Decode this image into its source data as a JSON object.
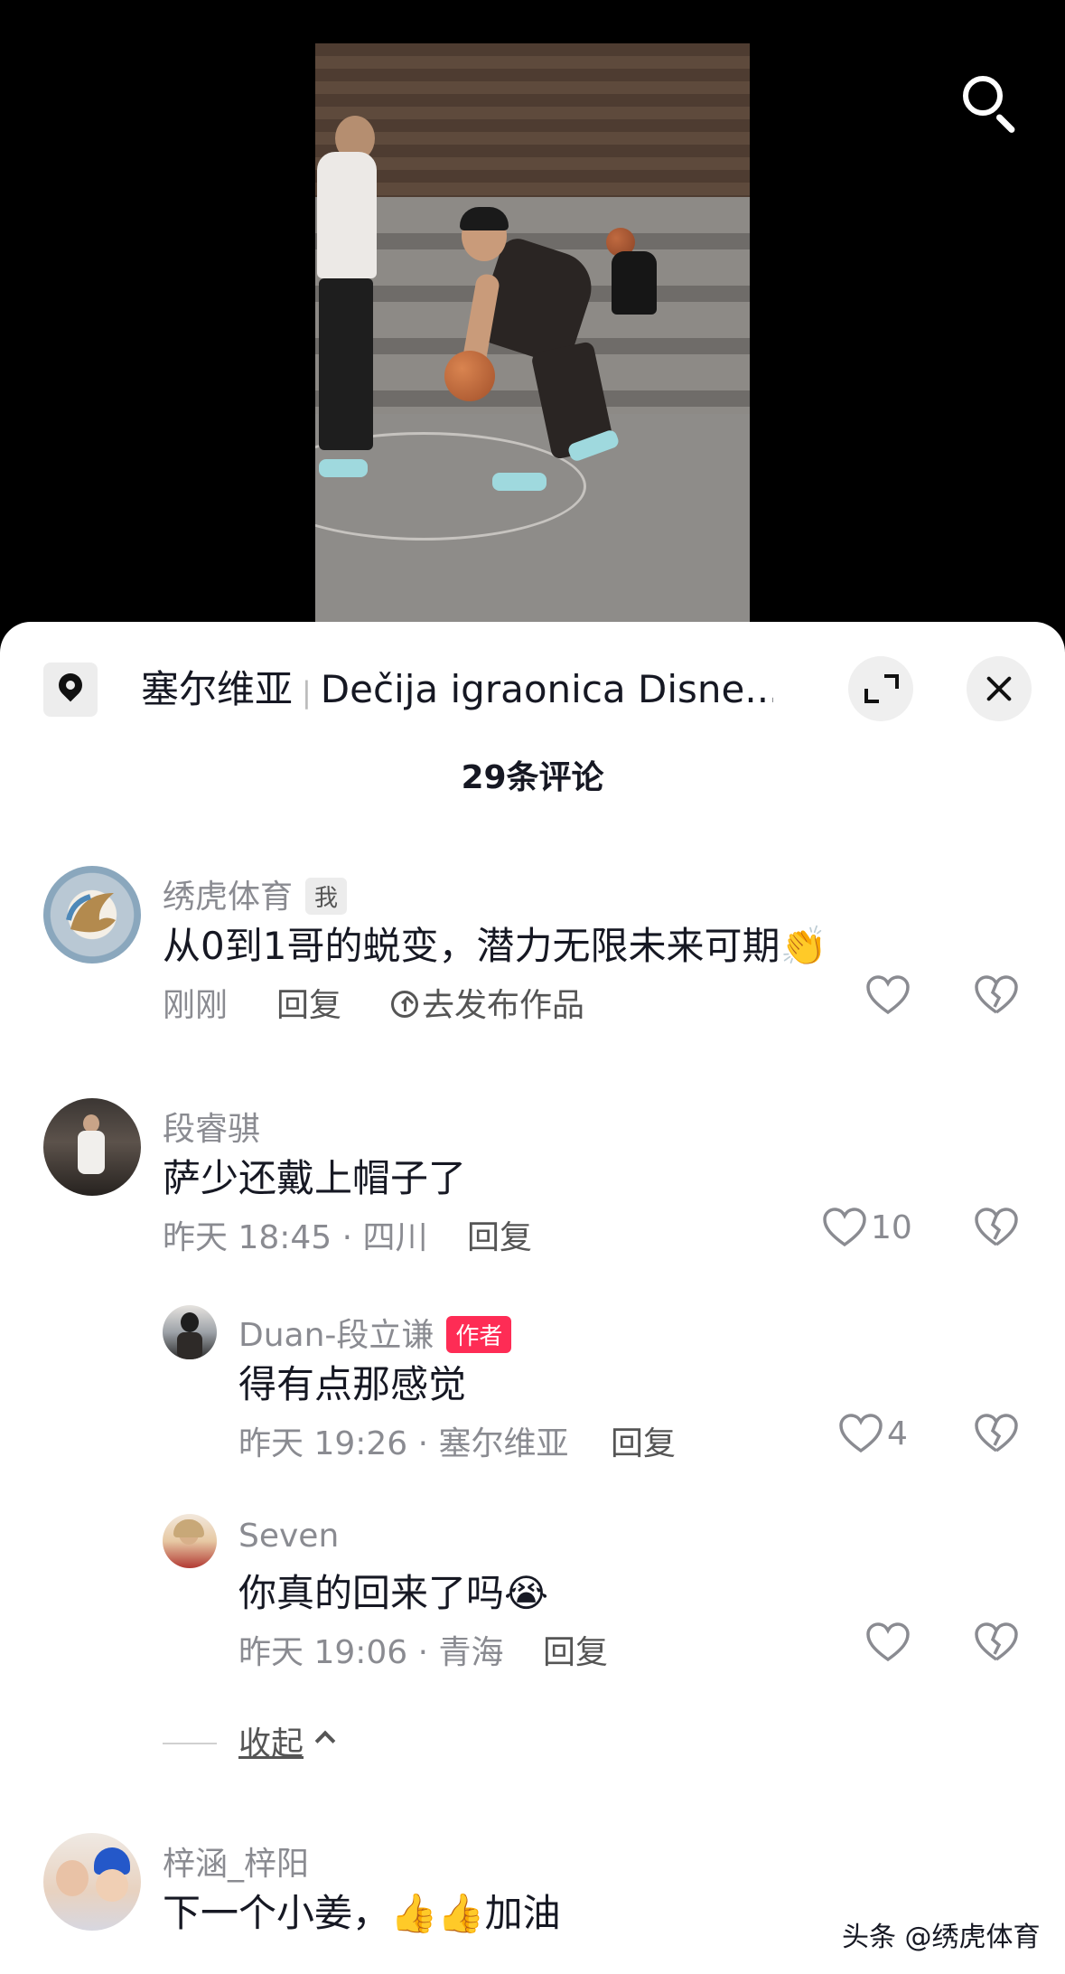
{
  "location": {
    "country": "塞尔维亚",
    "place": "Dečija igraonica Disne..."
  },
  "comment_count": "29条评论",
  "comments": [
    {
      "user": "绣虎体育",
      "badge": "我",
      "text": "从0到1哥的蜕变，潜力无限未来可期",
      "emoji": "👏",
      "time": "刚刚",
      "reply_label": "回复",
      "publish_label": "去发布作品",
      "likes": ""
    },
    {
      "user": "段睿骐",
      "text": "萨少还戴上帽子了",
      "time": "昨天 18:45 · 四川",
      "reply_label": "回复",
      "likes": "10"
    }
  ],
  "replies": [
    {
      "user": "Duan-段立谦",
      "badge": "作者",
      "text": "得有点那感觉",
      "time": "昨天 19:26 · 塞尔维亚",
      "reply_label": "回复",
      "likes": "4"
    },
    {
      "user": "Seven",
      "text": "你真的回来了吗",
      "emoji": "😭",
      "time": "昨天 19:06 · 青海",
      "reply_label": "回复",
      "likes": ""
    }
  ],
  "collapse_label": "收起",
  "last_comment": {
    "user": "梓涵_梓阳",
    "text_a": "下一个小姜，",
    "emoji": "👍👍",
    "text_b": "加油"
  },
  "watermark": "头条 @绣虎体育",
  "colors": {
    "author_tag": "#fe2c55",
    "meta_gray": "#8a8b91",
    "text": "#161823"
  }
}
